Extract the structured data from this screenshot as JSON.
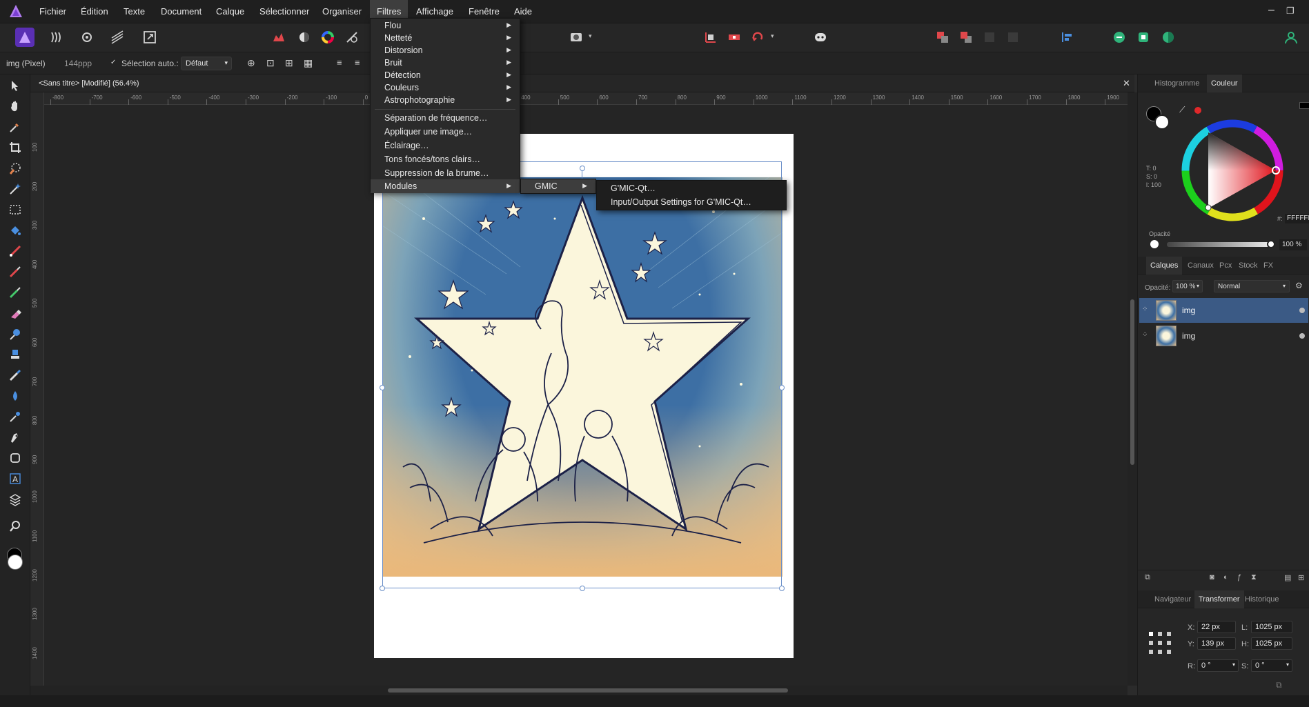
{
  "menubar": {
    "items": [
      "Fichier",
      "Édition",
      "Texte",
      "Document",
      "Calque",
      "Sélectionner",
      "Organiser",
      "Filtres",
      "Affichage",
      "Fenêtre",
      "Aide"
    ],
    "active_item": "Filtres"
  },
  "context": {
    "layer_type": "img (Pixel)",
    "resolution": "144ppp",
    "auto_select_label": "Sélection auto.:",
    "auto_select_value": "Défaut"
  },
  "document": {
    "tab_title": "<Sans titre> [Modifié] (56.4%)",
    "ruler_unit": "px",
    "ruler_h_ticks": [
      "-800",
      "-700",
      "-600",
      "-500",
      "-400",
      "-300",
      "-200",
      "-100",
      "0",
      "100",
      "200",
      "300",
      "400",
      "500",
      "600",
      "700",
      "800",
      "900",
      "1000",
      "1100",
      "1200",
      "1300",
      "1400",
      "1500",
      "1600",
      "1700",
      "1800",
      "1900"
    ],
    "ruler_v_ticks": [
      "100",
      "200",
      "300",
      "400",
      "500",
      "600",
      "700",
      "800",
      "900",
      "1000",
      "1100",
      "1200",
      "1300",
      "1400"
    ]
  },
  "filters_menu": {
    "items": [
      {
        "label": "Flou",
        "submenu": true
      },
      {
        "label": "Netteté",
        "submenu": true
      },
      {
        "label": "Distorsion",
        "submenu": true
      },
      {
        "label": "Bruit",
        "submenu": true
      },
      {
        "label": "Détection",
        "submenu": true
      },
      {
        "label": "Couleurs",
        "submenu": true
      },
      {
        "label": "Astrophotographie",
        "submenu": true
      },
      {
        "label": "Séparation de fréquence…",
        "submenu": false
      },
      {
        "label": "Appliquer une image…",
        "submenu": false
      },
      {
        "label": "Éclairage…",
        "submenu": false
      },
      {
        "label": "Tons foncés/tons clairs…",
        "submenu": false
      },
      {
        "label": "Suppression de la brume…",
        "submenu": false
      },
      {
        "label": "Modules",
        "submenu": true
      }
    ],
    "modules_submenu": [
      "GMIC"
    ],
    "gmic_submenu": [
      "G'MIC-Qt…",
      "Input/Output Settings for G'MIC-Qt…"
    ]
  },
  "right_panel": {
    "top_tabs": [
      "Histogramme",
      "Couleur"
    ],
    "color": {
      "t": "T: 0",
      "s": "S: 0",
      "l": "l: 100",
      "hex_prefix": "#:",
      "hex": "FFFFFF",
      "opacity_label": "Opacité",
      "opacity_value": "100 %",
      "accent": "#e0282a"
    },
    "layer_tabs": [
      "Calques",
      "Canaux",
      "Pcx",
      "Stock",
      "FX"
    ],
    "layers_opacity_label": "Opacité:",
    "layers_opacity_value": "100 %",
    "blend_mode": "Normal",
    "layers": [
      {
        "name": "img",
        "selected": true
      },
      {
        "name": "img",
        "selected": false
      }
    ],
    "bottom_tabs": [
      "Navigateur",
      "Transformer",
      "Historique"
    ],
    "transform": {
      "x_label": "X:",
      "x": "22 px",
      "y_label": "Y:",
      "y": "139 px",
      "w_label": "L:",
      "w": "1025 px",
      "h_label": "H:",
      "h": "1025 px",
      "r_label": "R:",
      "r": "0 °",
      "s_label": "S:",
      "s": "0 °"
    }
  }
}
